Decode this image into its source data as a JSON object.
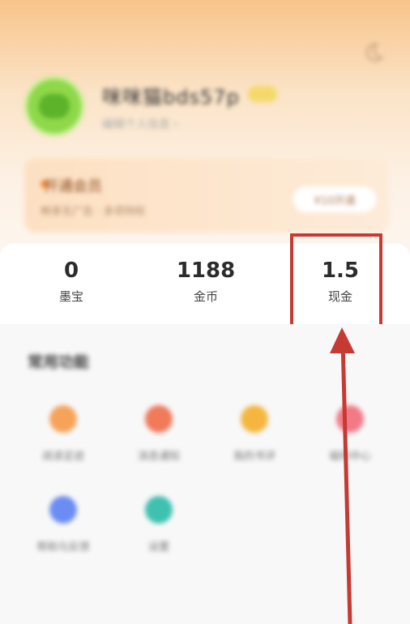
{
  "header": {
    "username": "咪咪猫bds57p",
    "user_subtitle": "编辑个人信息 ›"
  },
  "member_card": {
    "title": "开通会员",
    "description": "畅享无广告 · 多项特权",
    "button_label": "¥10开通"
  },
  "stats": [
    {
      "value": "0",
      "label": "墨宝"
    },
    {
      "value": "1188",
      "label": "金币"
    },
    {
      "value": "1.5",
      "label": "现金"
    }
  ],
  "section": {
    "title": "常用功能",
    "items": [
      {
        "label": "阅读足迹",
        "color": "#f6a35a"
      },
      {
        "label": "消息通知",
        "color": "#f07a5a"
      },
      {
        "label": "我的书评",
        "color": "#f5b640"
      },
      {
        "label": "福利中心",
        "color": "#f07a85"
      },
      {
        "label": "帮助与反馈",
        "color": "#6b8cf2"
      },
      {
        "label": "设置",
        "color": "#3ec1b0"
      }
    ]
  },
  "colors": {
    "highlight": "#c63a33",
    "accent": "#f8c48a"
  }
}
